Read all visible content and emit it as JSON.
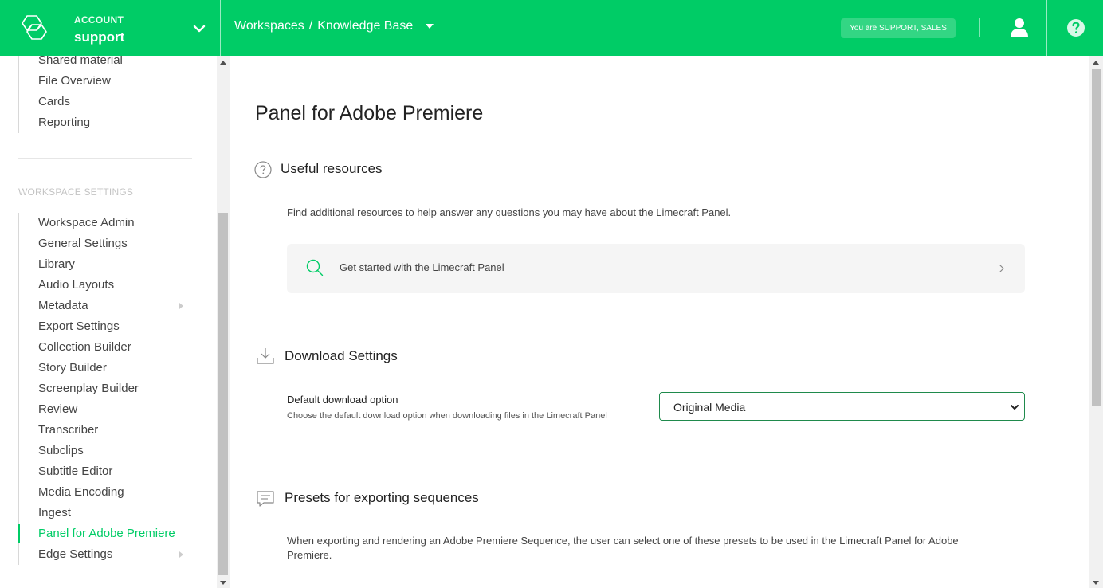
{
  "header": {
    "account_label": "ACCOUNT",
    "account_name": "support",
    "breadcrumb_root": "Workspaces",
    "breadcrumb_separator": "/",
    "breadcrumb_current": "Knowledge Base",
    "role_badge": "You are SUPPORT, SALES",
    "icons": [
      "logo-icon",
      "chevron-down-icon",
      "user-icon",
      "help-icon"
    ],
    "brand_color": "#00cc66"
  },
  "sidebar": {
    "top_items": [
      {
        "label": "Shared material"
      },
      {
        "label": "File Overview"
      },
      {
        "label": "Cards"
      },
      {
        "label": "Reporting"
      }
    ],
    "section_title": "WORKSPACE SETTINGS",
    "settings_items": [
      {
        "label": "Workspace Admin"
      },
      {
        "label": "General Settings"
      },
      {
        "label": "Library"
      },
      {
        "label": "Audio Layouts"
      },
      {
        "label": "Metadata"
      },
      {
        "label": "Export Settings"
      },
      {
        "label": "Collection Builder"
      },
      {
        "label": "Story Builder"
      },
      {
        "label": "Screenplay Builder"
      },
      {
        "label": "Review"
      },
      {
        "label": "Transcriber"
      },
      {
        "label": "Subclips"
      },
      {
        "label": "Subtitle Editor"
      },
      {
        "label": "Media Encoding"
      },
      {
        "label": "Ingest"
      },
      {
        "label": "Panel for Adobe Premiere"
      },
      {
        "label": "Edge Settings"
      }
    ],
    "active_item": "Panel for Adobe Premiere"
  },
  "main": {
    "page_title": "Panel for Adobe Premiere",
    "resources": {
      "title": "Useful resources",
      "description": "Find additional resources to help answer any questions you may have about the Limecraft Panel.",
      "card_label": "Get started with the Limecraft Panel"
    },
    "download": {
      "title": "Download Settings",
      "field_label": "Default download option",
      "field_help": "Choose the default download option when downloading files in the Limecraft Panel",
      "selected_value": "Original Media"
    },
    "presets": {
      "title": "Presets for exporting sequences",
      "description": "When exporting and rendering an Adobe Premiere Sequence, the user can select one of these presets to be used in the Limecraft Panel for Adobe Premiere."
    }
  }
}
